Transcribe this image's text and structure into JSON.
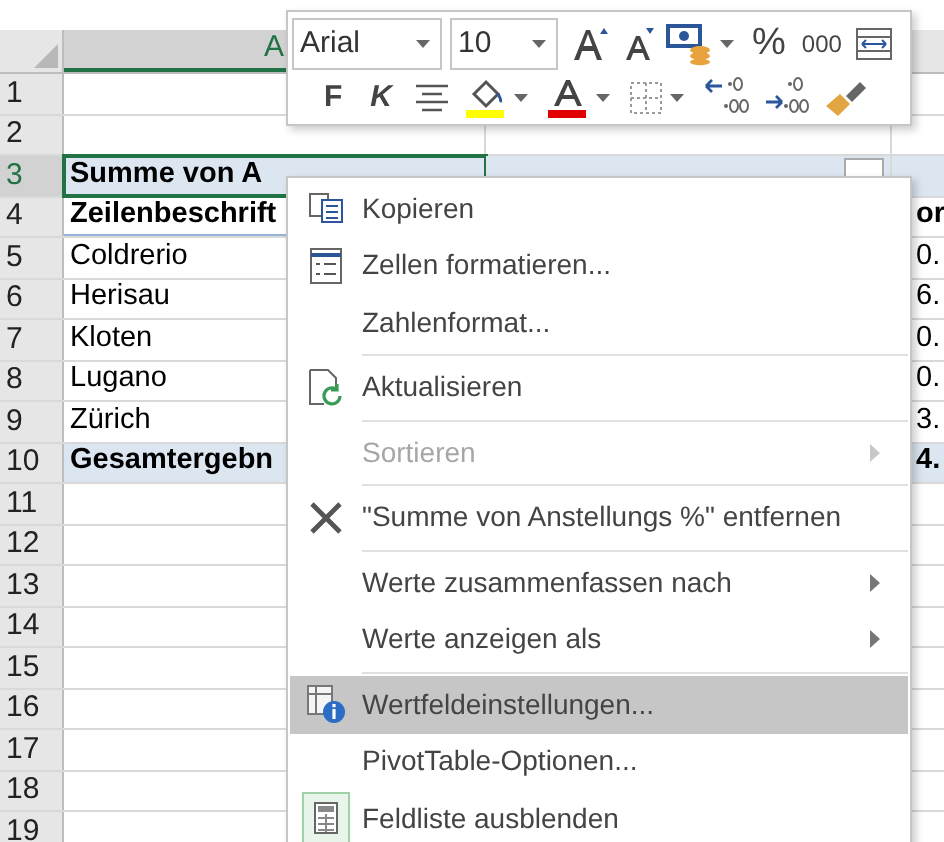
{
  "toolbar": {
    "font": "Arial",
    "size": "10",
    "row1": [
      {
        "kind": "grow"
      },
      {
        "kind": "shrink"
      },
      {
        "kind": "currency"
      },
      {
        "kind": "text",
        "label": "%"
      },
      {
        "kind": "text",
        "label": "000"
      },
      {
        "kind": "wrap"
      }
    ],
    "row2": [
      {
        "kind": "bold",
        "label": "F"
      },
      {
        "kind": "italic",
        "label": "K"
      },
      {
        "kind": "align"
      },
      {
        "kind": "fill"
      },
      {
        "kind": "fontcolor"
      },
      {
        "kind": "border"
      },
      {
        "kind": "incdec"
      },
      {
        "kind": "decdec"
      },
      {
        "kind": "painter"
      }
    ]
  },
  "sheet": {
    "column_header": {
      "label": "A",
      "selected": true
    },
    "rows": [
      {
        "number": "1",
        "kind": "empty",
        "selected": false
      },
      {
        "number": "2",
        "kind": "empty",
        "selected": false
      },
      {
        "number": "3",
        "kind": "title",
        "selected": true,
        "a": "Summe von A"
      },
      {
        "number": "4",
        "kind": "header",
        "selected": false,
        "a": "Zeilenbeschrift",
        "c": "or"
      },
      {
        "number": "5",
        "kind": "data",
        "selected": false,
        "a": "Coldrerio",
        "c": "0."
      },
      {
        "number": "6",
        "kind": "data",
        "selected": false,
        "a": "Herisau",
        "c": "6."
      },
      {
        "number": "7",
        "kind": "data",
        "selected": false,
        "a": "Kloten",
        "c": "0."
      },
      {
        "number": "8",
        "kind": "data",
        "selected": false,
        "a": "Lugano",
        "c": "0."
      },
      {
        "number": "9",
        "kind": "data",
        "selected": false,
        "a": "Zürich",
        "c": "3."
      },
      {
        "number": "10",
        "kind": "total",
        "selected": false,
        "a": "Gesamtergebn",
        "c": "4."
      },
      {
        "number": "11",
        "kind": "empty",
        "selected": false
      },
      {
        "number": "12",
        "kind": "empty",
        "selected": false
      },
      {
        "number": "13",
        "kind": "empty",
        "selected": false
      },
      {
        "number": "14",
        "kind": "empty",
        "selected": false
      },
      {
        "number": "15",
        "kind": "empty",
        "selected": false
      },
      {
        "number": "16",
        "kind": "empty",
        "selected": false
      },
      {
        "number": "17",
        "kind": "empty",
        "selected": false
      },
      {
        "number": "18",
        "kind": "empty",
        "selected": false
      },
      {
        "number": "19",
        "kind": "empty",
        "selected": false
      }
    ]
  },
  "context_menu": [
    {
      "kind": "item",
      "label": "Kopieren",
      "disabled": false,
      "submenu": false,
      "selected": false
    },
    {
      "kind": "item",
      "label": "Zellen formatieren...",
      "disabled": false,
      "submenu": false,
      "selected": false
    },
    {
      "kind": "item",
      "label": "Zahlenformat...",
      "disabled": false,
      "submenu": false,
      "selected": false
    },
    {
      "kind": "separator"
    },
    {
      "kind": "item",
      "label": "Aktualisieren",
      "disabled": false,
      "submenu": false,
      "selected": false
    },
    {
      "kind": "separator"
    },
    {
      "kind": "item",
      "label": "Sortieren",
      "disabled": true,
      "submenu": true,
      "selected": false
    },
    {
      "kind": "separator"
    },
    {
      "kind": "item",
      "label": "\"Summe von Anstellungs %\" entfernen",
      "disabled": false,
      "submenu": false,
      "selected": false
    },
    {
      "kind": "separator"
    },
    {
      "kind": "item",
      "label": "Werte zusammenfassen nach",
      "disabled": false,
      "submenu": true,
      "selected": false
    },
    {
      "kind": "item",
      "label": "Werte anzeigen als",
      "disabled": false,
      "submenu": true,
      "selected": false
    },
    {
      "kind": "separator"
    },
    {
      "kind": "item",
      "label": "Wertfeldeinstellungen...",
      "disabled": false,
      "submenu": false,
      "selected": true
    },
    {
      "kind": "item",
      "label": "PivotTable-Optionen...",
      "disabled": false,
      "submenu": false,
      "selected": false
    },
    {
      "kind": "item",
      "label": "Feldliste ausblenden",
      "disabled": false,
      "submenu": false,
      "selected": false
    }
  ]
}
